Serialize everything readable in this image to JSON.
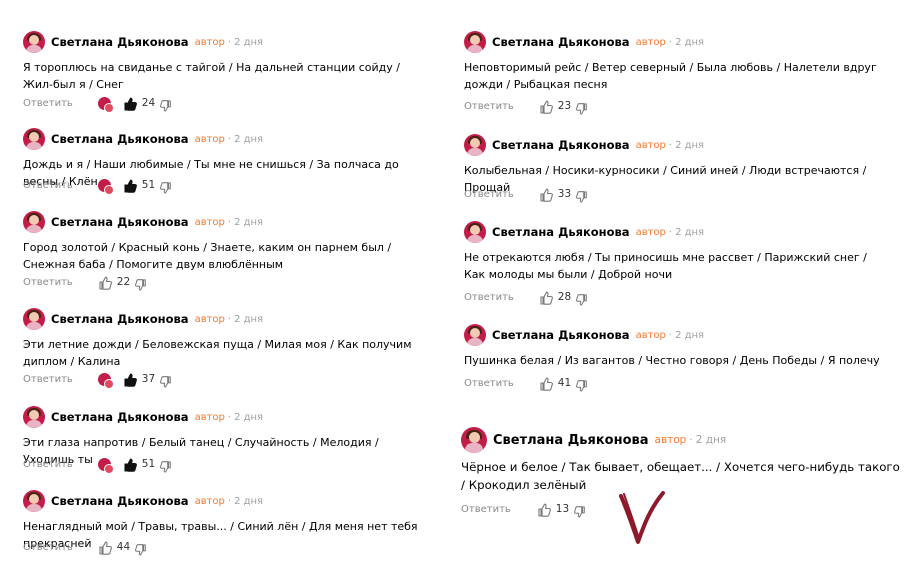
{
  "comments": [
    {
      "author": "Светлана Дьяконова",
      "role": "автор",
      "dot": "·",
      "time": "2 дня",
      "text": "Я тороплюсь на свиданье с тайгой / На дальней станции сойду / Жил-был я / Снег",
      "reply_label": "Ответить",
      "likes": "24",
      "liked": true
    },
    {
      "author": "Светлана Дьяконова",
      "role": "автор",
      "dot": "·",
      "time": "2 дня",
      "text": "Дождь и я / Наши любимые / Ты мне не снишься / За полчаса до весны / Клён",
      "reply_label": "Ответить",
      "likes": "51",
      "liked": true
    },
    {
      "author": "Светлана Дьяконова",
      "role": "автор",
      "dot": "·",
      "time": "2 дня",
      "text": "Город золотой / Красный конь / Знаете, каким он парнем был / Снежная баба / Помогите двум влюблённым",
      "reply_label": "Ответить",
      "likes": "22",
      "liked": false
    },
    {
      "author": "Светлана Дьяконова",
      "role": "автор",
      "dot": "·",
      "time": "2 дня",
      "text": "Эти летние дожди / Беловежская пуща / Милая моя / Как получим диплом / Калина",
      "reply_label": "Ответить",
      "likes": "37",
      "liked": true
    },
    {
      "author": "Светлана Дьяконова",
      "role": "автор",
      "dot": "·",
      "time": "2 дня",
      "text": "Эти глаза напротив / Белый танец / Случайность / Мелодия / Уходишь ты",
      "reply_label": "Ответить",
      "likes": "51",
      "liked": true
    },
    {
      "author": "Светлана Дьяконова",
      "role": "автор",
      "dot": "·",
      "time": "2 дня",
      "text": "Ненаглядный мой / Травы, травы... / Синий лён / Для меня нет тебя прекрасней",
      "reply_label": "Ответить",
      "likes": "44",
      "liked": false
    },
    {
      "author": "Светлана Дьяконова",
      "role": "автор",
      "dot": "·",
      "time": "2 дня",
      "text": "Неповторимый рейс / Ветер северный / Была любовь / Налетели вдруг дожди / Рыбацкая песня",
      "reply_label": "Ответить",
      "likes": "23",
      "liked": false
    },
    {
      "author": "Светлана Дьяконова",
      "role": "автор",
      "dot": "·",
      "time": "2 дня",
      "text": "Колыбельная / Носики-курносики / Синий иней / Люди встречаются / Прощай",
      "reply_label": "Ответить",
      "likes": "33",
      "liked": false
    },
    {
      "author": "Светлана Дьяконова",
      "role": "автор",
      "dot": "·",
      "time": "2 дня",
      "text": "Не отрекаются любя / Ты приносишь мне рассвет / Парижский снег / Как молоды мы были / Доброй ночи",
      "reply_label": "Ответить",
      "likes": "28",
      "liked": false
    },
    {
      "author": "Светлана Дьяконова",
      "role": "автор",
      "dot": "·",
      "time": "2 дня",
      "text": "Пушинка белая / Из вагантов / Честно говоря / День Победы / Я полечу",
      "reply_label": "Ответить",
      "likes": "41",
      "liked": false
    },
    {
      "author": "Светлана Дьяконова",
      "role": "автор",
      "dot": "·",
      "time": "2 дня",
      "text": "Чёрное и белое / Так бывает, обещает... / Хочется чего-нибудь такого / Крокодил зелёный",
      "reply_label": "Ответить",
      "likes": "13",
      "liked": false
    }
  ],
  "colors": {
    "accent": "#c21d49",
    "role": "#f07a2f",
    "muted": "#8a8a8a",
    "checkmark": "#8b1a2b"
  },
  "icons": {
    "like": "thumbs-up-icon",
    "dislike": "thumbs-down-icon",
    "avatar": "avatar",
    "reaction": "heart-reaction-icon",
    "mark": "checkmark-icon"
  }
}
